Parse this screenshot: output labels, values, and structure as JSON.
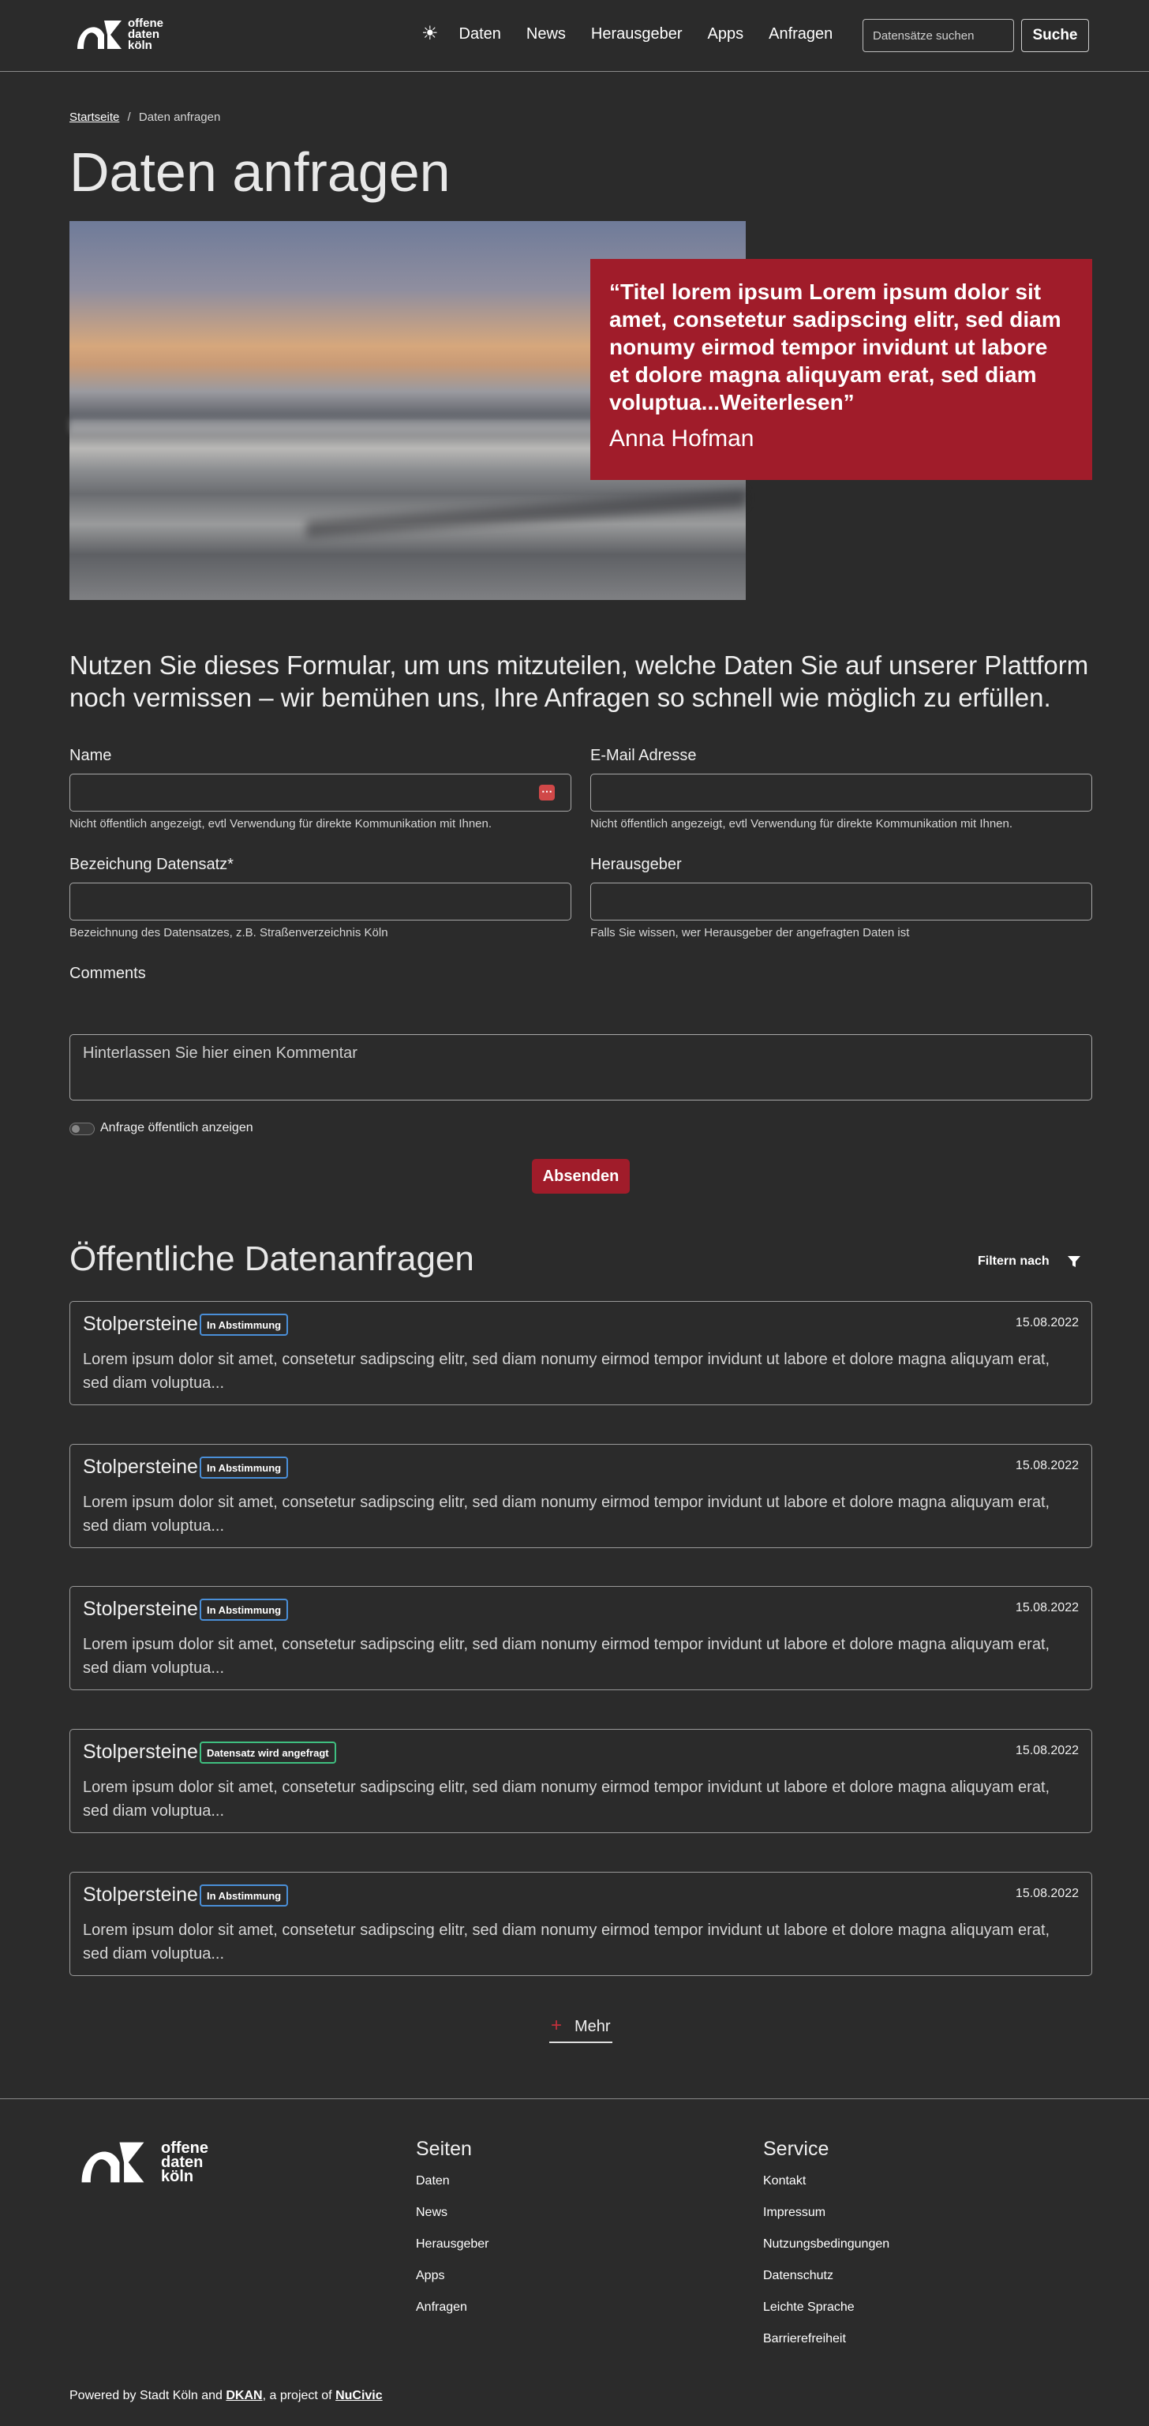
{
  "header": {
    "logo_line1": "offene",
    "logo_line2": "daten",
    "logo_line3": "köln",
    "theme_icon": "☀",
    "nav": [
      "Daten",
      "News",
      "Herausgeber",
      "Apps",
      "Anfragen"
    ],
    "search_placeholder": "Datensätze suchen",
    "search_button": "Suche"
  },
  "breadcrumb": {
    "home": "Startseite",
    "separator": "/",
    "current": "Daten anfragen"
  },
  "page_title": "Daten anfragen",
  "quote": {
    "text": "“Titel lorem ipsum Lorem ipsum dolor sit amet, consetetur sadipscing elitr, sed diam nonumy eirmod tempor invidunt ut labore et dolore magna aliquyam erat, sed diam voluptua...Weiterlesen”",
    "author": "Anna Hofman"
  },
  "intro": "Nutzen Sie dieses Formular, um uns mitzuteilen, welche Daten Sie auf unserer Plattform noch vermissen – wir bemühen uns, Ihre Anfragen so schnell wie möglich zu erfüllen.",
  "form": {
    "name_label": "Name",
    "name_help": "Nicht öffentlich angezeigt, evtl Verwendung für direkte Kommunikation mit Ihnen.",
    "email_label": "E-Mail Adresse",
    "email_help": "Nicht öffentlich angezeigt, evtl Verwendung für direkte Kommunikation mit Ihnen.",
    "dataset_label": "Bezeichung Datensatz*",
    "dataset_help": "Bezeichnung des Datensatzes, z.B. Straßenverzeichnis Köln",
    "publisher_label": "Herausgeber",
    "publisher_help": "Falls Sie wissen, wer Herausgeber der angefragten Daten ist",
    "comments_label": "Comments",
    "comments_placeholder": "Hinterlassen Sie hier einen Kommentar",
    "toggle_label": "Anfrage öffentlich anzeigen",
    "submit": "Absenden"
  },
  "requests": {
    "title": "Öffentliche Datenanfragen",
    "filter_label": "Filtern nach",
    "items": [
      {
        "title": "Stolpersteine",
        "status": "In Abstimmung",
        "date": "15.08.2022",
        "text": "Lorem ipsum dolor sit amet, consetetur sadipscing elitr, sed diam nonumy eirmod tempor invidunt ut labore et dolore magna aliquyam erat, sed diam voluptua..."
      },
      {
        "title": "Stolpersteine",
        "status": "In Abstimmung",
        "date": "15.08.2022",
        "text": "Lorem ipsum dolor sit amet, consetetur sadipscing elitr, sed diam nonumy eirmod tempor invidunt ut labore et dolore magna aliquyam erat, sed diam voluptua..."
      },
      {
        "title": "Stolpersteine",
        "status": "In Abstimmung",
        "date": "15.08.2022",
        "text": "Lorem ipsum dolor sit amet, consetetur sadipscing elitr, sed diam nonumy eirmod tempor invidunt ut labore et dolore magna aliquyam erat, sed diam voluptua..."
      },
      {
        "title": "Stolpersteine",
        "status": "Datensatz wird angefragt",
        "date": "15.08.2022",
        "text": "Lorem ipsum dolor sit amet, consetetur sadipscing elitr, sed diam nonumy eirmod tempor invidunt ut labore et dolore magna aliquyam erat, sed diam voluptua..."
      },
      {
        "title": "Stolpersteine",
        "status": "In Abstimmung",
        "date": "15.08.2022",
        "text": "Lorem ipsum dolor sit amet, consetetur sadipscing elitr, sed diam nonumy eirmod tempor invidunt ut labore et dolore magna aliquyam erat, sed diam voluptua..."
      }
    ],
    "more": "Mehr"
  },
  "footer": {
    "pages_title": "Seiten",
    "pages": [
      "Daten",
      "News",
      "Herausgeber",
      "Apps",
      "Anfragen"
    ],
    "service_title": "Service",
    "service": [
      "Kontakt",
      "Impressum",
      "Nutzungsbedingungen",
      "Datenschutz",
      "Leichte Sprache",
      "Barrierefreiheit"
    ],
    "powered_prefix": "Powered by Stadt Köln and ",
    "powered_dkan": "DKAN",
    "powered_middle": ", a project of ",
    "powered_nucivic": "NuCivic"
  },
  "colors": {
    "background": "#2b2b2b",
    "accent": "#a01c2a",
    "badge_blue": "#4a8fd8",
    "badge_green": "#3fbf80"
  }
}
